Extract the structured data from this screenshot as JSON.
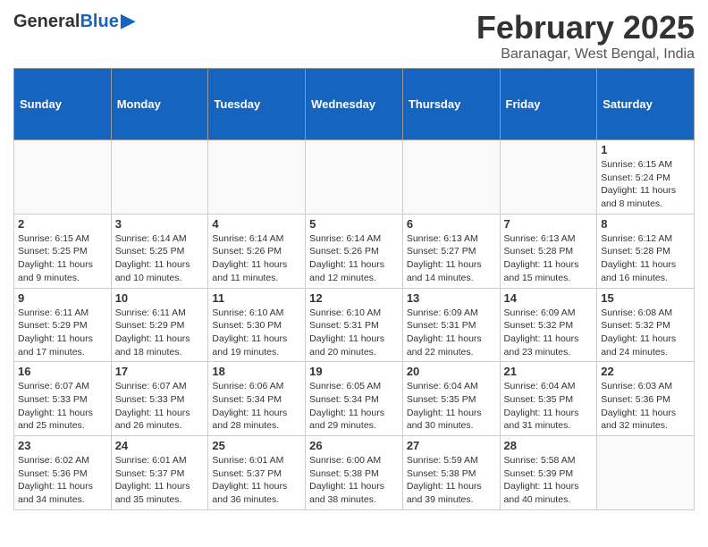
{
  "header": {
    "logo_general": "General",
    "logo_blue": "Blue",
    "month_title": "February 2025",
    "location": "Baranagar, West Bengal, India"
  },
  "days_of_week": [
    "Sunday",
    "Monday",
    "Tuesday",
    "Wednesday",
    "Thursday",
    "Friday",
    "Saturday"
  ],
  "weeks": [
    [
      {
        "day": "",
        "empty": true
      },
      {
        "day": "",
        "empty": true
      },
      {
        "day": "",
        "empty": true
      },
      {
        "day": "",
        "empty": true
      },
      {
        "day": "",
        "empty": true
      },
      {
        "day": "",
        "empty": true
      },
      {
        "day": "1",
        "info": "Sunrise: 6:15 AM\nSunset: 5:24 PM\nDaylight: 11 hours and 8 minutes."
      }
    ],
    [
      {
        "day": "2",
        "info": "Sunrise: 6:15 AM\nSunset: 5:25 PM\nDaylight: 11 hours and 9 minutes."
      },
      {
        "day": "3",
        "info": "Sunrise: 6:14 AM\nSunset: 5:25 PM\nDaylight: 11 hours and 10 minutes."
      },
      {
        "day": "4",
        "info": "Sunrise: 6:14 AM\nSunset: 5:26 PM\nDaylight: 11 hours and 11 minutes."
      },
      {
        "day": "5",
        "info": "Sunrise: 6:14 AM\nSunset: 5:26 PM\nDaylight: 11 hours and 12 minutes."
      },
      {
        "day": "6",
        "info": "Sunrise: 6:13 AM\nSunset: 5:27 PM\nDaylight: 11 hours and 14 minutes."
      },
      {
        "day": "7",
        "info": "Sunrise: 6:13 AM\nSunset: 5:28 PM\nDaylight: 11 hours and 15 minutes."
      },
      {
        "day": "8",
        "info": "Sunrise: 6:12 AM\nSunset: 5:28 PM\nDaylight: 11 hours and 16 minutes."
      }
    ],
    [
      {
        "day": "9",
        "info": "Sunrise: 6:11 AM\nSunset: 5:29 PM\nDaylight: 11 hours and 17 minutes."
      },
      {
        "day": "10",
        "info": "Sunrise: 6:11 AM\nSunset: 5:29 PM\nDaylight: 11 hours and 18 minutes."
      },
      {
        "day": "11",
        "info": "Sunrise: 6:10 AM\nSunset: 5:30 PM\nDaylight: 11 hours and 19 minutes."
      },
      {
        "day": "12",
        "info": "Sunrise: 6:10 AM\nSunset: 5:31 PM\nDaylight: 11 hours and 20 minutes."
      },
      {
        "day": "13",
        "info": "Sunrise: 6:09 AM\nSunset: 5:31 PM\nDaylight: 11 hours and 22 minutes."
      },
      {
        "day": "14",
        "info": "Sunrise: 6:09 AM\nSunset: 5:32 PM\nDaylight: 11 hours and 23 minutes."
      },
      {
        "day": "15",
        "info": "Sunrise: 6:08 AM\nSunset: 5:32 PM\nDaylight: 11 hours and 24 minutes."
      }
    ],
    [
      {
        "day": "16",
        "info": "Sunrise: 6:07 AM\nSunset: 5:33 PM\nDaylight: 11 hours and 25 minutes."
      },
      {
        "day": "17",
        "info": "Sunrise: 6:07 AM\nSunset: 5:33 PM\nDaylight: 11 hours and 26 minutes."
      },
      {
        "day": "18",
        "info": "Sunrise: 6:06 AM\nSunset: 5:34 PM\nDaylight: 11 hours and 28 minutes."
      },
      {
        "day": "19",
        "info": "Sunrise: 6:05 AM\nSunset: 5:34 PM\nDaylight: 11 hours and 29 minutes."
      },
      {
        "day": "20",
        "info": "Sunrise: 6:04 AM\nSunset: 5:35 PM\nDaylight: 11 hours and 30 minutes."
      },
      {
        "day": "21",
        "info": "Sunrise: 6:04 AM\nSunset: 5:35 PM\nDaylight: 11 hours and 31 minutes."
      },
      {
        "day": "22",
        "info": "Sunrise: 6:03 AM\nSunset: 5:36 PM\nDaylight: 11 hours and 32 minutes."
      }
    ],
    [
      {
        "day": "23",
        "info": "Sunrise: 6:02 AM\nSunset: 5:36 PM\nDaylight: 11 hours and 34 minutes."
      },
      {
        "day": "24",
        "info": "Sunrise: 6:01 AM\nSunset: 5:37 PM\nDaylight: 11 hours and 35 minutes."
      },
      {
        "day": "25",
        "info": "Sunrise: 6:01 AM\nSunset: 5:37 PM\nDaylight: 11 hours and 36 minutes."
      },
      {
        "day": "26",
        "info": "Sunrise: 6:00 AM\nSunset: 5:38 PM\nDaylight: 11 hours and 38 minutes."
      },
      {
        "day": "27",
        "info": "Sunrise: 5:59 AM\nSunset: 5:38 PM\nDaylight: 11 hours and 39 minutes."
      },
      {
        "day": "28",
        "info": "Sunrise: 5:58 AM\nSunset: 5:39 PM\nDaylight: 11 hours and 40 minutes."
      },
      {
        "day": "",
        "empty": true
      }
    ]
  ]
}
